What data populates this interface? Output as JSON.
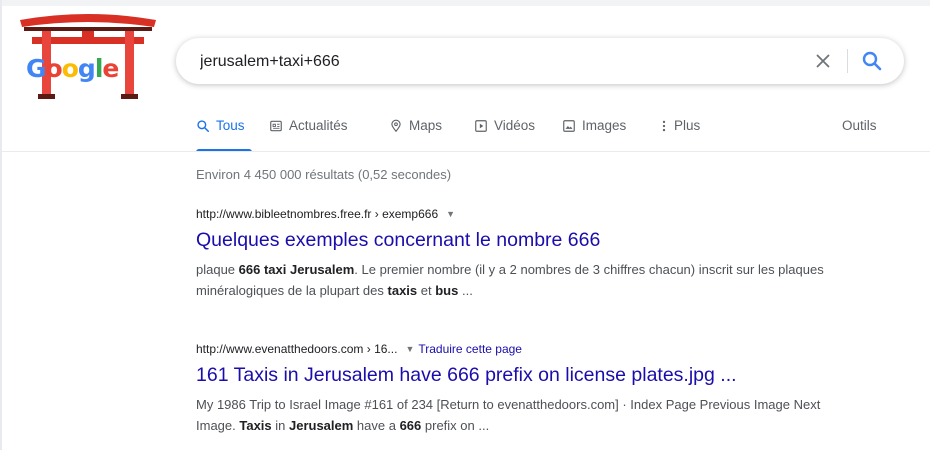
{
  "logo": {
    "text": "Google",
    "colors": [
      "#4285f4",
      "#ea4335",
      "#fbbc05",
      "#4285f4",
      "#34a853",
      "#ea4335"
    ]
  },
  "search": {
    "query": "jerusalem+taxi+666",
    "clear_icon": "close-icon",
    "search_icon": "search-icon"
  },
  "tabs": [
    {
      "label": "Tous",
      "icon": "search-icon",
      "active": true
    },
    {
      "label": "Actualités",
      "icon": "newspaper-icon",
      "active": false
    },
    {
      "label": "Maps",
      "icon": "map-pin-icon",
      "active": false
    },
    {
      "label": "Vidéos",
      "icon": "play-icon",
      "active": false
    },
    {
      "label": "Images",
      "icon": "image-icon",
      "active": false
    },
    {
      "label": "Plus",
      "icon": "more-vert-icon",
      "active": false
    }
  ],
  "tools_label": "Outils",
  "stats": "Environ 4 450 000 résultats (0,52 secondes)",
  "results": [
    {
      "url": "http://www.bibleetnombres.free.fr › exemp666",
      "title": "Quelques exemples concernant le nombre 666",
      "snippet_parts": [
        {
          "t": "plaque ",
          "b": false
        },
        {
          "t": "666 taxi Jerusalem",
          "b": true
        },
        {
          "t": ". Le premier nombre (il y a 2 nombres de 3 chiffres chacun) inscrit sur les plaques minéralogiques de la plupart des ",
          "b": false
        },
        {
          "t": "taxis",
          "b": true
        },
        {
          "t": " et ",
          "b": false
        },
        {
          "t": "bus",
          "b": true
        },
        {
          "t": " ...",
          "b": false
        }
      ]
    },
    {
      "url": "http://www.evenatthedoors.com › 16...",
      "translate": "Traduire cette page",
      "title": "161 Taxis in Jerusalem have 666 prefix on license plates.jpg ...",
      "snippet_parts": [
        {
          "t": "My 1986 Trip to Israel Image #161 of 234 [Return to evenatthedoors.com] · Index Page Previous Image Next Image. ",
          "b": false
        },
        {
          "t": "Taxis",
          "b": true
        },
        {
          "t": " in ",
          "b": false
        },
        {
          "t": "Jerusalem",
          "b": true
        },
        {
          "t": " have a ",
          "b": false
        },
        {
          "t": "666",
          "b": true
        },
        {
          "t": " prefix on ...",
          "b": false
        }
      ]
    }
  ],
  "colors": {
    "link": "#1a0dab",
    "accent": "#1a73e8",
    "muted": "#70757a",
    "snippet": "#4d5156"
  }
}
